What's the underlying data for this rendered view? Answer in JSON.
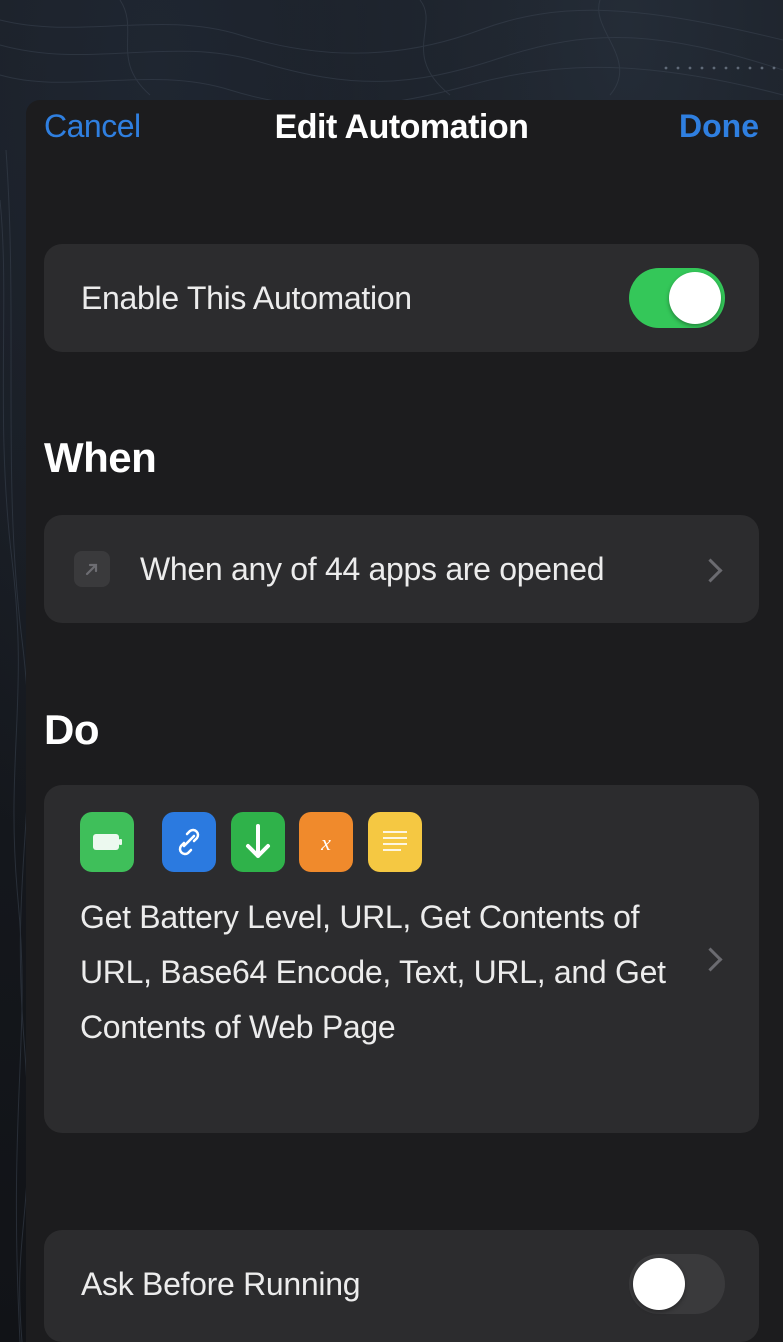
{
  "nav": {
    "cancel_label": "Cancel",
    "title": "Edit Automation",
    "done_label": "Done"
  },
  "enable": {
    "label": "Enable This Automation",
    "on": true
  },
  "when": {
    "header": "When",
    "trigger_label": "When any of 44 apps are opened",
    "icon": "open-app-icon"
  },
  "do": {
    "header": "Do",
    "actions_summary": "Get Battery Level, URL, Get Contents of URL, Base64 Encode, Text, URL, and Get Contents of Web Page",
    "action_icons": [
      {
        "name": "battery-icon",
        "color": "#3fbf5a"
      },
      {
        "name": "link-icon",
        "color": "#2b7ae0"
      },
      {
        "name": "download-arrow-icon",
        "color": "#2fb24a"
      },
      {
        "name": "variable-x-icon",
        "color": "#f08a2c"
      },
      {
        "name": "text-lines-icon",
        "color": "#f5c842"
      }
    ]
  },
  "ask": {
    "label": "Ask Before Running",
    "on": false
  },
  "colors": {
    "accent": "#2f7fe0",
    "toggle_on": "#34c759"
  }
}
